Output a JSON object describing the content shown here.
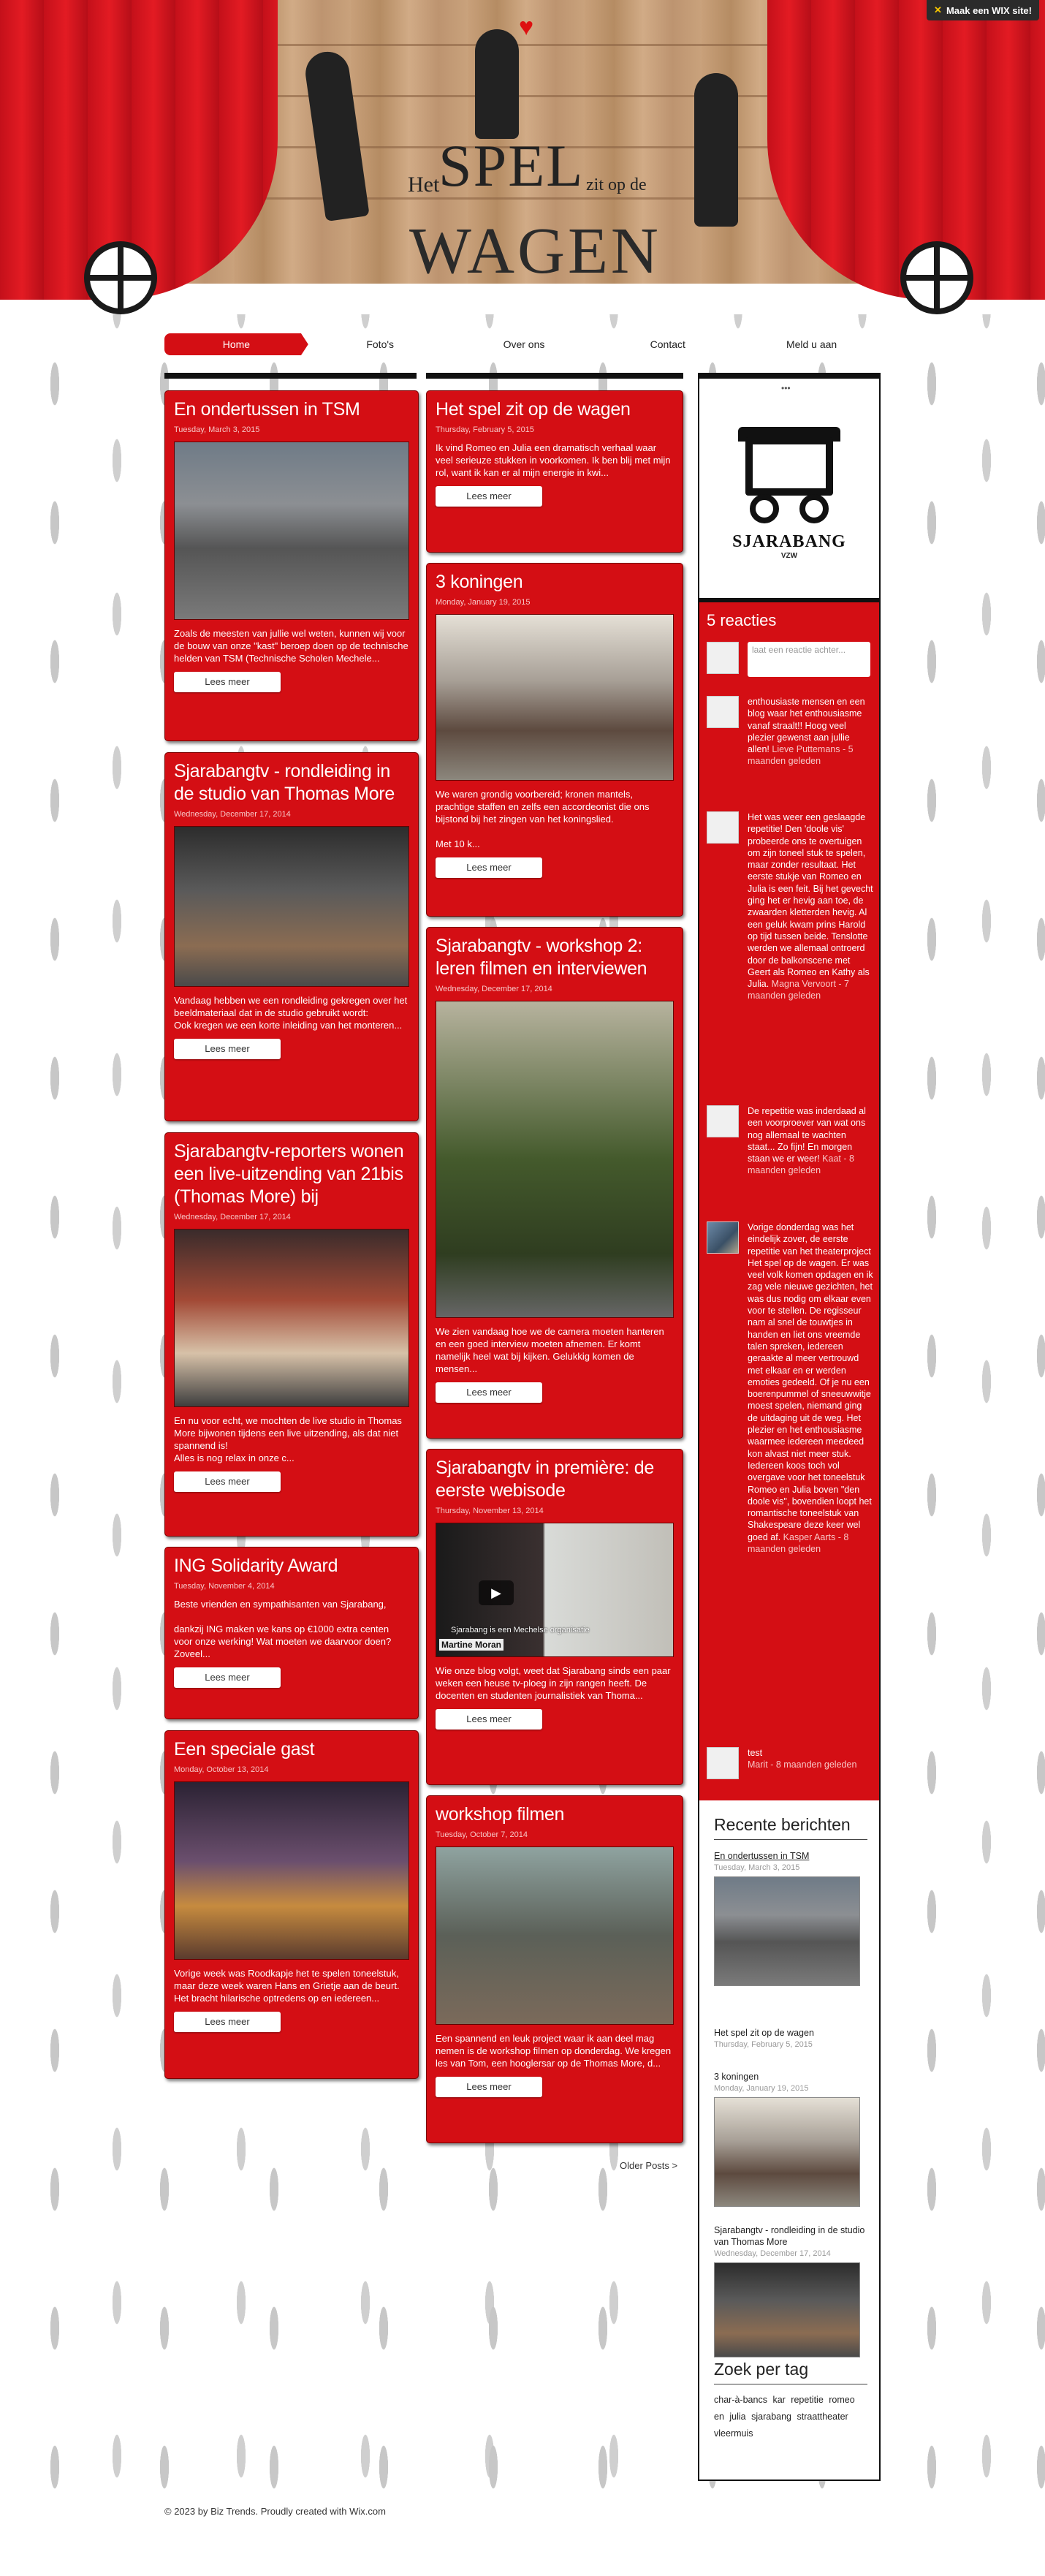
{
  "wix_banner": "Maak een WIX site!",
  "logo": {
    "het": "Het",
    "spel": "SPEL",
    "zit": "zit op de",
    "wagen": "WAGEN"
  },
  "nav": [
    "Home",
    "Foto's",
    "Over ons",
    "Contact",
    "Meld u aan"
  ],
  "posts": [
    {
      "title": "En ondertussen in TSM",
      "date": "Tuesday, March 3, 2015",
      "excerpt": "Zoals de meesten van jullie wel weten, kunnen wij voor de bouw van onze \"kast\" beroep doen op de technische helden van TSM (Technische Scholen Mechele...",
      "button": "Lees meer"
    },
    {
      "title": "Sjarabangtv - rondleiding in de studio van Thomas More",
      "date": "Wednesday, December 17, 2014",
      "excerpt": "Vandaag hebben we een rondleiding gekregen over het beeldmateriaal dat in de studio gebruikt wordt:\nOok kregen we een korte inleiding van het monteren...",
      "button": "Lees meer"
    },
    {
      "title": "Sjarabangtv-reporters wonen een live-uitzending van 21bis (Thomas More) bij",
      "date": "Wednesday, December 17, 2014",
      "excerpt": "En nu voor echt, we mochten de live studio in Thomas More bijwonen tijdens een live uitzending, als dat niet spannend is!\nAlles is nog relax in onze c...",
      "button": "Lees meer"
    },
    {
      "title": "ING Solidarity Award",
      "date": "Tuesday, November 4, 2014",
      "excerpt": "Beste vrienden en sympathisanten van Sjarabang,\n\ndankzij ING maken we kans op €1000 extra centen voor onze werking! Wat moeten we daarvoor doen? Zoveel...",
      "button": "Lees meer"
    },
    {
      "title": "Een speciale gast",
      "date": "Monday, October 13, 2014",
      "excerpt": "Vorige week was Roodkapje het te spelen toneelstuk, maar deze week waren Hans en Grietje aan de beurt. Het bracht hilarische optredens op en iedereen...",
      "button": "Lees meer"
    },
    {
      "title": "Het spel zit op de wagen",
      "date": "Thursday, February 5, 2015",
      "excerpt": "Ik vind Romeo en Julia een dramatisch verhaal waar veel serieuze stukken in voorkomen. Ik ben blij met mijn rol, want ik kan er al mijn energie in kwi...",
      "button": "Lees meer"
    },
    {
      "title": "3 koningen",
      "date": "Monday, January 19, 2015",
      "excerpt": "We waren grondig voorbereid; kronen mantels, prachtige staffen en zelfs een accordeonist die ons bijstond bij het zingen van het koningslied.\n\nMet 10 k...",
      "button": "Lees meer"
    },
    {
      "title": "Sjarabangtv - workshop 2: leren filmen en interviewen",
      "date": "Wednesday, December 17, 2014",
      "excerpt": "We zien vandaag hoe we de camera moeten hanteren en een goed interview moeten afnemen. Er komt namelijk heel wat bij kijken. Gelukkig komen de mensen...",
      "button": "Lees meer"
    },
    {
      "title": "Sjarabangtv in première: de eerste webisode",
      "date": "Thursday, November 13, 2014",
      "excerpt": "Wie onze blog volgt, weet dat Sjarabang sinds een paar weken een heuse tv-ploeg in zijn rangen heeft. De docenten en studenten journalistiek van Thoma...",
      "button": "Lees meer",
      "video_caption": "Sjarabang is een Mechelse organisatie",
      "video_name": "Martine Moran"
    },
    {
      "title": "workshop filmen",
      "date": "Tuesday, October 7, 2014",
      "excerpt": "Een spannend en leuk project waar ik aan deel mag nemen is de workshop filmen op donderdag. We kregen les van Tom, een hooglersar op de Thomas More, d...",
      "button": "Lees meer"
    }
  ],
  "older": "Older Posts >",
  "sidebar": {
    "brand": "SJARABANG",
    "brand_sub": "VZW",
    "comments_title": "5 reacties",
    "reply_placeholder": "laat een reactie achter...",
    "comments": [
      {
        "text": "enthousiaste mensen en een blog waar het enthousiasme vanaf straalt!! Hoog veel plezier gewenst aan jullie allen!",
        "meta": "Lieve Puttemans - 5 maanden geleden"
      },
      {
        "text": "Het was weer een geslaagde repetitie! Den 'doole vis' probeerde ons te overtuigen om zijn toneel stuk te spelen, maar zonder resultaat. Het eerste stukje van Romeo en Julia is een feit. Bij het gevecht ging het er hevig aan toe, de zwaarden kletterden hevig. Al een geluk kwam prins Harold op tijd tussen beide. Tenslotte werden we allemaal ontroerd door de balkonscene met Geert als Romeo en Kathy als Julia.",
        "meta": "Magna Vervoort - 7 maanden geleden"
      },
      {
        "text": "De repetitie was inderdaad al een voorproever van wat ons nog allemaal te wachten staat... Zo fijn! En morgen staan we er weer!",
        "meta": "Kaat - 8 maanden geleden"
      },
      {
        "text": "Vorige donderdag was het eindelijk zover, de eerste repetitie van het theaterproject Het spel op de wagen. Er was veel volk komen opdagen en ik zag vele nieuwe gezichten, het was dus nodig om elkaar even voor te stellen. De regisseur nam al snel de touwtjes in handen en liet ons vreemde talen spreken, iedereen geraakte al meer vertrouwd met elkaar en er werden emoties gedeeld. Of je nu een boerenpummel of sneeuwwitje moest spelen, niemand ging de uitdaging uit de weg. Het plezier en het enthousiasme waarmee iedereen meedeed kon alvast niet meer stuk.\nIedereen koos toch vol overgave voor het toneelstuk Romeo en Julia boven \"den doole vis\", bovendien loopt het romantische toneelstuk van Shakespeare deze keer wel goed af.",
        "meta": "Kasper Aarts - 8 maanden geleden"
      },
      {
        "text": "test",
        "meta": "Marit - 8 maanden geleden"
      }
    ],
    "recent_title": "Recente berichten",
    "recent": [
      {
        "title": "En ondertussen in TSM",
        "date": "Tuesday, March 3, 2015"
      },
      {
        "title": "Het spel zit op de wagen",
        "date": "Thursday, February 5, 2015"
      },
      {
        "title": "3 koningen",
        "date": "Monday, January 19, 2015"
      },
      {
        "title": "Sjarabangtv - rondleiding in de studio van Thomas More",
        "date": "Wednesday, December 17, 2014"
      }
    ],
    "tags_title": "Zoek per tag",
    "tags": [
      "char-à-bancs",
      "kar",
      "repetitie",
      "romeo en julia",
      "sjarabang",
      "straattheater",
      "vleermuis"
    ]
  },
  "footer": "© 2023 by Biz Trends. Proudly created with Wix.com"
}
